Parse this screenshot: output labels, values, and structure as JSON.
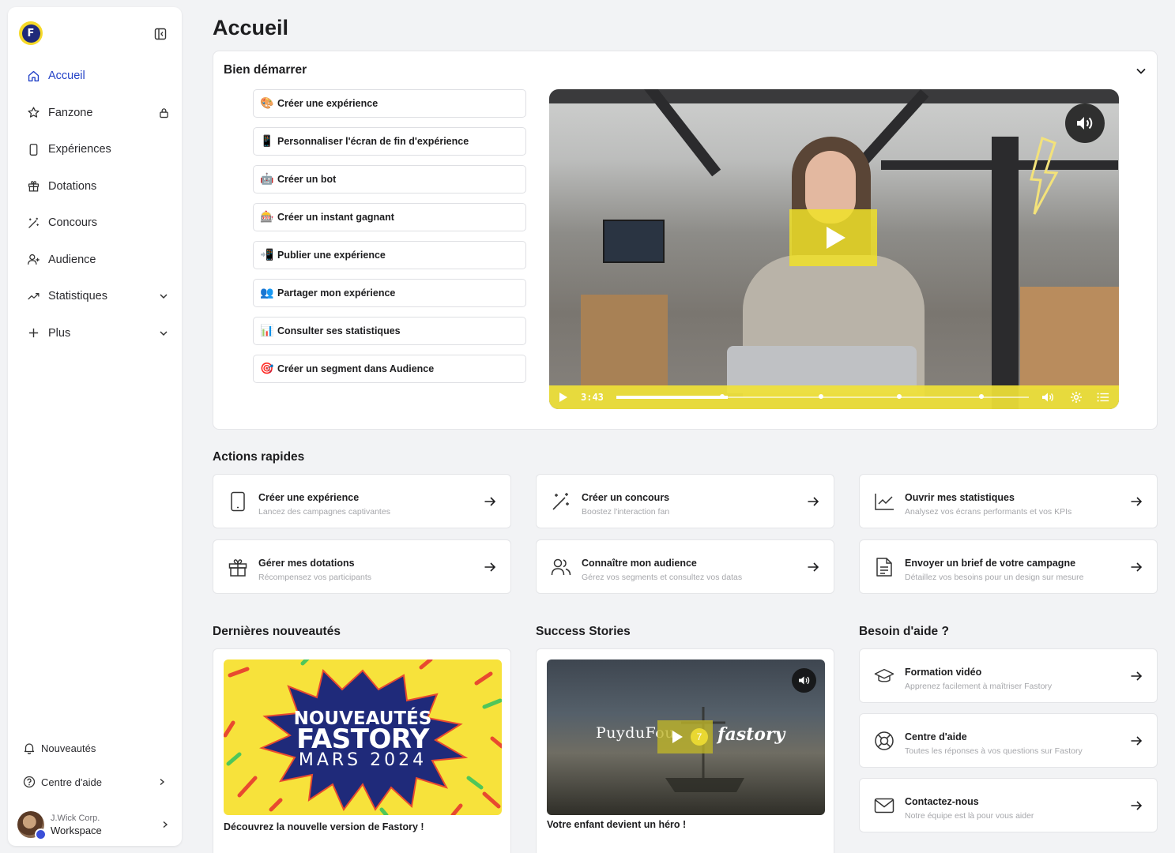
{
  "sidebar": {
    "logo_glyph": "F",
    "nav": [
      {
        "label": "Accueil",
        "icon": "home-icon",
        "active": true
      },
      {
        "label": "Fanzone",
        "icon": "star-icon",
        "right": "lock-icon"
      },
      {
        "label": "Expériences",
        "icon": "phone-icon"
      },
      {
        "label": "Dotations",
        "icon": "gift-icon"
      },
      {
        "label": "Concours",
        "icon": "magic-wand-icon"
      },
      {
        "label": "Audience",
        "icon": "user-plus-icon"
      },
      {
        "label": "Statistiques",
        "icon": "trend-icon",
        "right": "chevron-down-icon"
      },
      {
        "label": "Plus",
        "icon": "plus-icon",
        "right": "chevron-down-icon"
      }
    ],
    "bottom": {
      "news": "Nouveautés",
      "help": "Centre d'aide",
      "workspace_org": "J.Wick Corp.",
      "workspace_name": "Workspace"
    }
  },
  "header": {
    "title": "Accueil"
  },
  "getting_started": {
    "title": "Bien démarrer",
    "items": [
      {
        "emoji": "🎨",
        "label": "Créer une expérience"
      },
      {
        "emoji": "📱",
        "label": "Personnaliser l'écran de fin d'expérience"
      },
      {
        "emoji": "🤖",
        "label": "Créer un bot"
      },
      {
        "emoji": "🎰",
        "label": "Créer un instant gagnant"
      },
      {
        "emoji": "📲",
        "label": "Publier une expérience"
      },
      {
        "emoji": "👥",
        "label": "Partager mon expérience"
      },
      {
        "emoji": "📊",
        "label": "Consulter ses statistiques"
      },
      {
        "emoji": "🎯",
        "label": "Créer un segment dans Audience"
      }
    ],
    "video": {
      "time": "3:43",
      "progress": 0.27,
      "accent": "#f0e237"
    }
  },
  "quick_actions": {
    "title": "Actions rapides",
    "items": [
      {
        "icon": "tablet-icon",
        "title": "Créer une expérience",
        "subtitle": "Lancez des campagnes captivantes"
      },
      {
        "icon": "magic-wand-icon",
        "title": "Créer un concours",
        "subtitle": "Boostez l'interaction fan"
      },
      {
        "icon": "chart-line-icon",
        "title": "Ouvrir mes statistiques",
        "subtitle": "Analysez vos écrans performants et vos KPIs"
      },
      {
        "icon": "gift-icon",
        "title": "Gérer mes dotations",
        "subtitle": "Récompensez vos participants"
      },
      {
        "icon": "users-icon",
        "title": "Connaître mon audience",
        "subtitle": "Gérez vos segments et consultez vos datas"
      },
      {
        "icon": "document-icon",
        "title": "Envoyer un brief de votre campagne",
        "subtitle": "Détaillez vos besoins pour un design sur mesure"
      }
    ]
  },
  "news": {
    "title": "Dernières nouveautés",
    "banner_line1": "NOUVEAUTÉS",
    "banner_line2": "FASTORY",
    "banner_line3": "MARS 2024",
    "caption": "Découvrez la nouvelle version de Fastory !"
  },
  "stories": {
    "title": "Success Stories",
    "logo_left": "PuyduFou",
    "logo_right": "fastory",
    "caption": "Votre enfant devient un héro !"
  },
  "help": {
    "title": "Besoin d'aide ?",
    "items": [
      {
        "icon": "graduation-cap-icon",
        "title": "Formation vidéo",
        "subtitle": "Apprenez facilement à maîtriser Fastory"
      },
      {
        "icon": "lifebuoy-icon",
        "title": "Centre d'aide",
        "subtitle": "Toutes les réponses à vos questions sur Fastory"
      },
      {
        "icon": "mail-icon",
        "title": "Contactez-nous",
        "subtitle": "Notre équipe est là pour vous aider"
      }
    ]
  }
}
